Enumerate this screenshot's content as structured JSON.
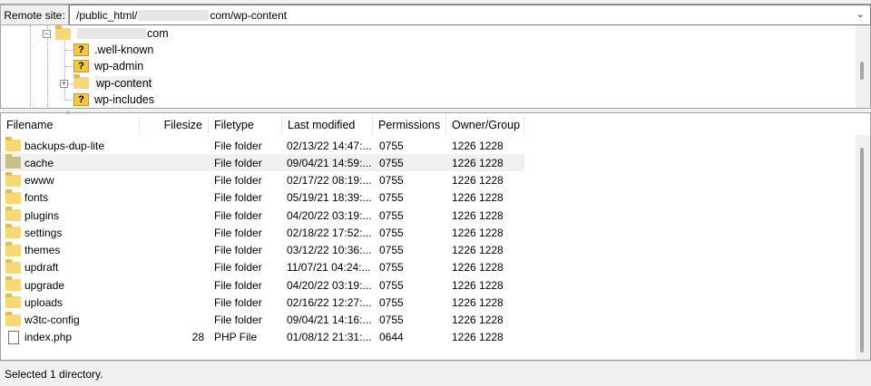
{
  "remote_site": {
    "label": "Remote site:",
    "path_prefix": "/public_html/",
    "path_suffix": "com/wp-content"
  },
  "tree": {
    "root_suffix": "com",
    "children": [
      {
        "name": ".well-known",
        "icon": "question-folder-icon"
      },
      {
        "name": "wp-admin",
        "icon": "question-folder-icon"
      },
      {
        "name": "wp-content",
        "icon": "folder-icon"
      },
      {
        "name": "wp-includes",
        "icon": "question-folder-icon"
      }
    ]
  },
  "columns": [
    "Filename",
    "Filesize",
    "Filetype",
    "Last modified",
    "Permissions",
    "Owner/Group"
  ],
  "files": [
    {
      "name": "backups-dup-lite",
      "size": "",
      "type": "File folder",
      "modified": "02/13/22 14:47:...",
      "perm": "0755",
      "owner": "1226 1228"
    },
    {
      "name": "cache",
      "size": "",
      "type": "File folder",
      "modified": "09/04/21 14:59:...",
      "perm": "0755",
      "owner": "1226 1228"
    },
    {
      "name": "ewww",
      "size": "",
      "type": "File folder",
      "modified": "02/17/22 08:19:...",
      "perm": "0755",
      "owner": "1226 1228"
    },
    {
      "name": "fonts",
      "size": "",
      "type": "File folder",
      "modified": "05/19/21 18:39:...",
      "perm": "0755",
      "owner": "1226 1228"
    },
    {
      "name": "plugins",
      "size": "",
      "type": "File folder",
      "modified": "04/20/22 03:19:...",
      "perm": "0755",
      "owner": "1226 1228"
    },
    {
      "name": "settings",
      "size": "",
      "type": "File folder",
      "modified": "02/18/22 17:52:...",
      "perm": "0755",
      "owner": "1226 1228"
    },
    {
      "name": "themes",
      "size": "",
      "type": "File folder",
      "modified": "03/12/22 10:36:...",
      "perm": "0755",
      "owner": "1226 1228"
    },
    {
      "name": "updraft",
      "size": "",
      "type": "File folder",
      "modified": "11/07/21 04:24:...",
      "perm": "0755",
      "owner": "1226 1228"
    },
    {
      "name": "upgrade",
      "size": "",
      "type": "File folder",
      "modified": "04/20/22 03:19:...",
      "perm": "0755",
      "owner": "1226 1228"
    },
    {
      "name": "uploads",
      "size": "",
      "type": "File folder",
      "modified": "02/16/22 12:27:...",
      "perm": "0755",
      "owner": "1226 1228"
    },
    {
      "name": "w3tc-config",
      "size": "",
      "type": "File folder",
      "modified": "09/04/21 14:16:...",
      "perm": "0755",
      "owner": "1226 1228"
    },
    {
      "name": "index.php",
      "size": "28",
      "type": "PHP File",
      "modified": "01/08/12 21:31:...",
      "perm": "0644",
      "owner": "1226 1228"
    }
  ],
  "selected_index": 1,
  "status": "Selected 1 directory."
}
